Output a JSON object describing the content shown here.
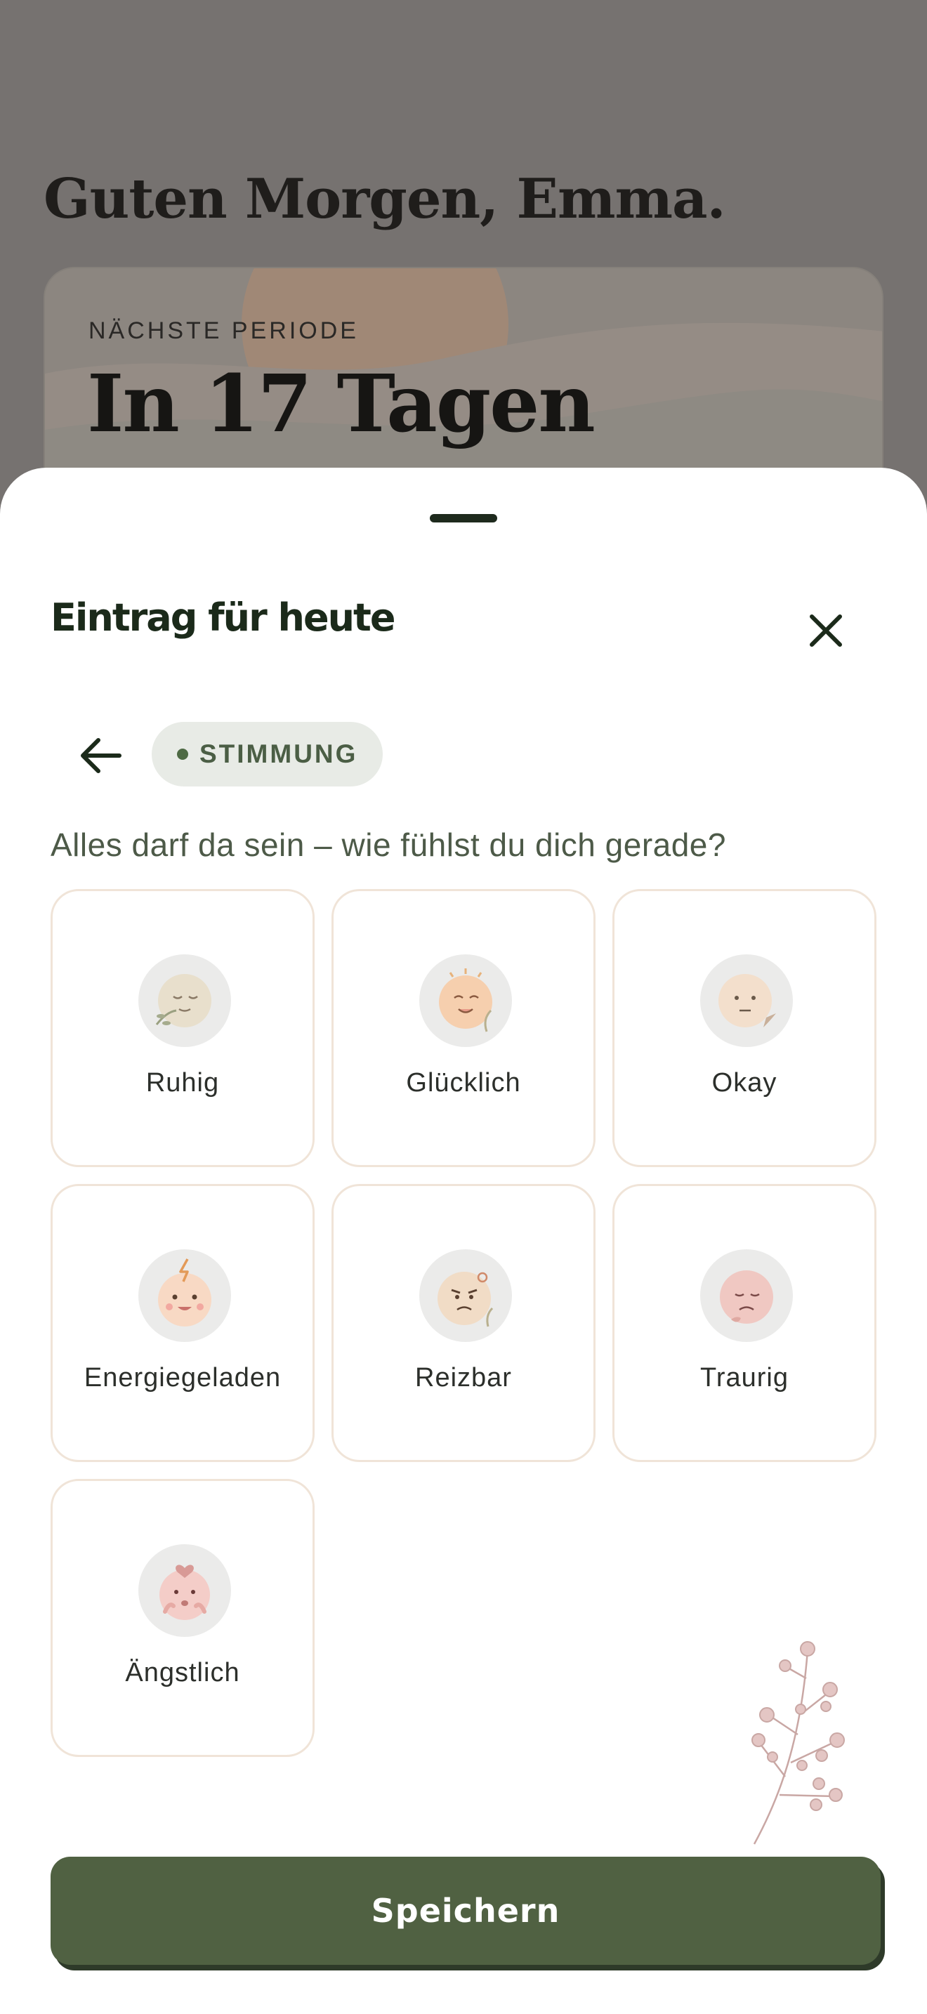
{
  "background": {
    "greeting": "Guten Morgen, Emma.",
    "period_card": {
      "eyebrow": "NÄCHSTE PERIODE",
      "value": "In 17 Tagen"
    }
  },
  "sheet": {
    "title": "Eintrag für heute",
    "category_chip": "STIMMUNG",
    "prompt": "Alles darf da sein – wie fühlst du dich gerade?",
    "moods": [
      {
        "label": "Ruhig",
        "icon": "calm-face-icon"
      },
      {
        "label": "Glücklich",
        "icon": "happy-face-icon"
      },
      {
        "label": "Okay",
        "icon": "neutral-face-icon"
      },
      {
        "label": "Energiegeladen",
        "icon": "energetic-face-icon"
      },
      {
        "label": "Reizbar",
        "icon": "irritable-face-icon"
      },
      {
        "label": "Traurig",
        "icon": "sad-face-icon"
      },
      {
        "label": "Ängstlich",
        "icon": "anxious-face-icon"
      }
    ],
    "save_label": "Speichern"
  },
  "colors": {
    "accent": "#506142",
    "card_border": "#f0e4d8",
    "chip_bg": "#e8ebe6",
    "scrim": "#767270"
  }
}
